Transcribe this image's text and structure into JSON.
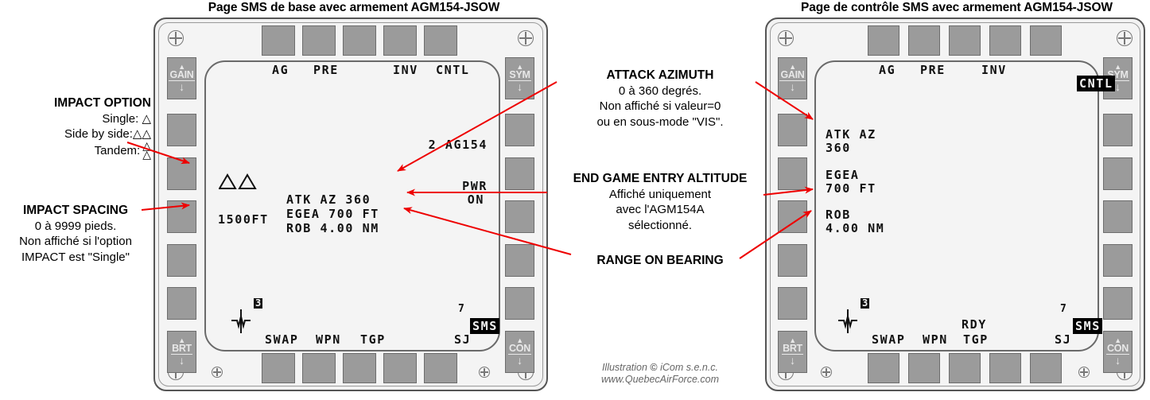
{
  "left_panel": {
    "title": "Page SMS de base avec armement AGM154-JSOW",
    "rockers": {
      "gain": "GAIN",
      "sym": "SYM",
      "brt": "BRT",
      "con": "CON"
    },
    "screen": {
      "top_labels": [
        "AG",
        "PRE",
        "INV",
        "CNTL"
      ],
      "store_count": "2 AG154",
      "power_line1": "PWR",
      "power_line2": "ON",
      "impact_spacing": "1500FT",
      "data_lines": [
        "ATK AZ 360",
        "EGEA 700 FT",
        "ROB 4.00 NM"
      ],
      "station_badge": "3",
      "station_right": "7",
      "bottom_labels": [
        "SWAP",
        "WPN",
        "TGP",
        "SMS",
        "SJ"
      ],
      "bottom_highlight": "SMS"
    }
  },
  "right_panel": {
    "title": "Page de contrôle SMS avec armement AGM154-JSOW",
    "rockers": {
      "gain": "GAIN",
      "sym": "SYM",
      "brt": "BRT",
      "con": "CON"
    },
    "screen": {
      "top_labels": [
        "AG",
        "PRE",
        "INV",
        "CNTL"
      ],
      "top_highlight": "CNTL",
      "fields": [
        {
          "label": "ATK AZ",
          "value": "360"
        },
        {
          "label": "EGEA",
          "value": "700 FT"
        },
        {
          "label": "ROB",
          "value": "4.00 NM"
        }
      ],
      "rdy": "RDY",
      "station_badge": "3",
      "station_right": "7",
      "bottom_labels": [
        "SWAP",
        "WPN",
        "TGP",
        "SMS",
        "SJ"
      ],
      "bottom_highlight": "SMS"
    }
  },
  "annotations": {
    "impact_option": {
      "heading": "IMPACT OPTION",
      "row1": "Single:",
      "row2": "Side by side:",
      "row3": "Tandem:"
    },
    "impact_spacing": {
      "heading": "IMPACT SPACING",
      "line1": "0 à 9999 pieds.",
      "line2": "Non affiché si l'option",
      "line3": "IMPACT est \"Single\""
    },
    "attack_azimuth": {
      "heading": "ATTACK AZIMUTH",
      "line1": "0 à 360 degrés.",
      "line2": "Non affiché si valeur=0",
      "line3": "ou en sous-mode \"VIS\"."
    },
    "end_game": {
      "heading": "END GAME ENTRY ALTITUDE",
      "line1": "Affiché uniquement",
      "line2": "avec l'AGM154A",
      "line3": "sélectionné."
    },
    "range_on_bearing": {
      "heading": "RANGE ON BEARING"
    }
  },
  "credit": {
    "line1_a": "Illustration ",
    "line1_b": "©",
    "line1_c": " iCom s.e.n.c.",
    "line2": "www.QuebecAirForce.com"
  },
  "colors": {
    "arrow": "#ee0000",
    "bezel": "#f2f2f2",
    "button": "#9b9b9b"
  }
}
